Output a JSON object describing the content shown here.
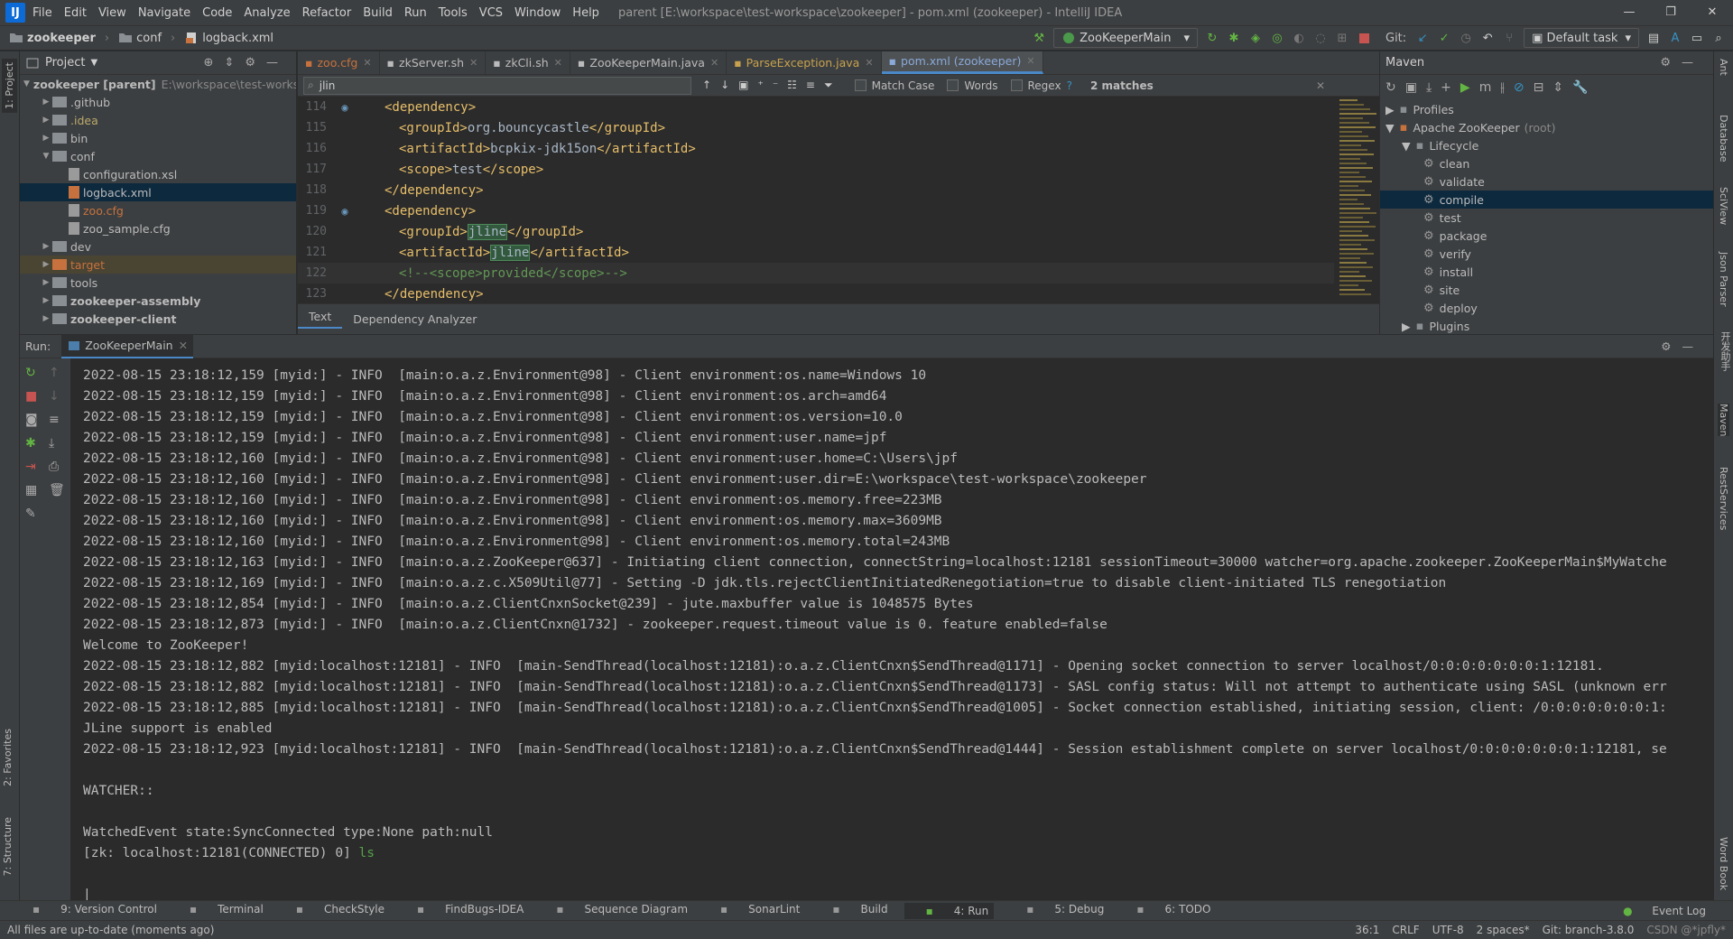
{
  "app": {
    "window_title": "parent [E:\\workspace\\test-workspace\\zookeeper] - pom.xml (zookeeper) - IntelliJ IDEA"
  },
  "menu": [
    "File",
    "Edit",
    "View",
    "Navigate",
    "Code",
    "Analyze",
    "Refactor",
    "Build",
    "Run",
    "Tools",
    "VCS",
    "Window",
    "Help"
  ],
  "window_controls": [
    "—",
    "❐",
    "✕"
  ],
  "nav": {
    "breadcrumbs": [
      "zookeeper",
      "conf",
      "logback.xml"
    ],
    "run_config": "ZooKeeperMain",
    "git_label": "Git:",
    "task": "Default task"
  },
  "project": {
    "title": "Project",
    "items": [
      {
        "label": "zookeeper [parent]",
        "extra": "E:\\workspace\\test-works",
        "bold": true,
        "arrow": "▼",
        "indent": 0
      },
      {
        "label": ".github",
        "arrow": "▶",
        "indent": 1
      },
      {
        "label": ".idea",
        "arrow": "▶",
        "indent": 1,
        "color": "#bba96a"
      },
      {
        "label": "bin",
        "arrow": "▶",
        "indent": 1
      },
      {
        "label": "conf",
        "arrow": "▼",
        "indent": 1
      },
      {
        "label": "configuration.xsl",
        "arrow": "",
        "indent": 2
      },
      {
        "label": "logback.xml",
        "arrow": "",
        "indent": 2,
        "sel": true
      },
      {
        "label": "zoo.cfg",
        "arrow": "",
        "indent": 2,
        "color": "#c7723e"
      },
      {
        "label": "zoo_sample.cfg",
        "arrow": "",
        "indent": 2
      },
      {
        "label": "dev",
        "arrow": "▶",
        "indent": 1
      },
      {
        "label": "target",
        "arrow": "▶",
        "indent": 1,
        "color": "#c7723e",
        "hl": true
      },
      {
        "label": "tools",
        "arrow": "▶",
        "indent": 1
      },
      {
        "label": "zookeeper-assembly",
        "arrow": "▶",
        "indent": 1,
        "bold": true
      },
      {
        "label": "zookeeper-client",
        "arrow": "▶",
        "indent": 1,
        "bold": true
      }
    ]
  },
  "editor": {
    "tabs": [
      {
        "label": "zoo.cfg",
        "color": "#c7723e"
      },
      {
        "label": "zkServer.sh",
        "color": "#bbbbbb"
      },
      {
        "label": "zkCli.sh",
        "color": "#bbbbbb"
      },
      {
        "label": "ZooKeeperMain.java",
        "color": "#bbbbbb"
      },
      {
        "label": "ParseException.java",
        "color": "#c7a24e"
      },
      {
        "label": "pom.xml (zookeeper)",
        "color": "#8aa8d8",
        "active": true
      }
    ],
    "search": {
      "query": "jlin",
      "match_case": "Match Case",
      "words": "Words",
      "regex": "Regex",
      "help": "?",
      "matches": "2 matches"
    },
    "lines": [
      {
        "n": "114",
        "html": "<span class='tagc'>&lt;dependency&gt;</span>",
        "indent": 4
      },
      {
        "n": "115",
        "html": "<span class='tagc'>&lt;groupId&gt;</span><span class='txt'>org.bouncycastle</span><span class='tagc'>&lt;/groupId&gt;</span>",
        "indent": 6
      },
      {
        "n": "116",
        "html": "<span class='tagc'>&lt;artifactId&gt;</span><span class='txt'>bcpkix-jdk15on</span><span class='tagc'>&lt;/artifactId&gt;</span>",
        "indent": 6
      },
      {
        "n": "117",
        "html": "<span class='tagc'>&lt;scope&gt;</span><span class='txt'>test</span><span class='tagc'>&lt;/scope&gt;</span>",
        "indent": 6
      },
      {
        "n": "118",
        "html": "<span class='tagc'>&lt;/dependency&gt;</span>",
        "indent": 4
      },
      {
        "n": "119",
        "html": "<span class='tagc'>&lt;dependency&gt;</span>",
        "indent": 4
      },
      {
        "n": "120",
        "html": "<span class='tagc'>&lt;groupId&gt;</span><span class='txt mark'>jline</span><span class='tagc'>&lt;/groupId&gt;</span>",
        "indent": 6
      },
      {
        "n": "121",
        "html": "<span class='tagc'>&lt;artifactId&gt;</span><span class='txt mark'>jline</span><span class='tagc'>&lt;/artifactId&gt;</span>",
        "indent": 6
      },
      {
        "n": "122",
        "html": "<span class='cmt'>&lt;!--&lt;scope&gt;provided&lt;/scope&gt;--&gt;</span>",
        "indent": 6,
        "active": true
      },
      {
        "n": "123",
        "html": "<span class='tagc'>&lt;/dependency&gt;</span>",
        "indent": 4
      }
    ],
    "bottom_tabs": [
      "Text",
      "Dependency Analyzer"
    ]
  },
  "maven": {
    "title": "Maven",
    "rows": [
      {
        "label": "Profiles",
        "arrow": "▶",
        "indent": 0,
        "icon": "folder"
      },
      {
        "label": "Apache ZooKeeper",
        "suffix": "(root)",
        "arrow": "▼",
        "indent": 0,
        "icon": "maven"
      },
      {
        "label": "Lifecycle",
        "arrow": "▼",
        "indent": 1,
        "icon": "folder"
      },
      {
        "label": "clean",
        "indent": 2,
        "icon": "gear"
      },
      {
        "label": "validate",
        "indent": 2,
        "icon": "gear"
      },
      {
        "label": "compile",
        "indent": 2,
        "icon": "gear",
        "sel": true
      },
      {
        "label": "test",
        "indent": 2,
        "icon": "gear"
      },
      {
        "label": "package",
        "indent": 2,
        "icon": "gear"
      },
      {
        "label": "verify",
        "indent": 2,
        "icon": "gear"
      },
      {
        "label": "install",
        "indent": 2,
        "icon": "gear"
      },
      {
        "label": "site",
        "indent": 2,
        "icon": "gear"
      },
      {
        "label": "deploy",
        "indent": 2,
        "icon": "gear"
      },
      {
        "label": "Plugins",
        "arrow": "▶",
        "indent": 1,
        "icon": "folder"
      }
    ]
  },
  "run": {
    "label": "Run:",
    "tab": "ZooKeeperMain",
    "console": [
      {
        "t": "2022-08-15 23:18:12,159 [myid:] - INFO  [main:o.a.z.Environment@98] - Client environment:os.name=Windows 10"
      },
      {
        "t": "2022-08-15 23:18:12,159 [myid:] - INFO  [main:o.a.z.Environment@98] - Client environment:os.arch=amd64"
      },
      {
        "t": "2022-08-15 23:18:12,159 [myid:] - INFO  [main:o.a.z.Environment@98] - Client environment:os.version=10.0"
      },
      {
        "t": "2022-08-15 23:18:12,159 [myid:] - INFO  [main:o.a.z.Environment@98] - Client environment:user.name=jpf"
      },
      {
        "t": "2022-08-15 23:18:12,160 [myid:] - INFO  [main:o.a.z.Environment@98] - Client environment:user.home=C:\\Users\\jpf"
      },
      {
        "t": "2022-08-15 23:18:12,160 [myid:] - INFO  [main:o.a.z.Environment@98] - Client environment:user.dir=E:\\workspace\\test-workspace\\zookeeper"
      },
      {
        "t": "2022-08-15 23:18:12,160 [myid:] - INFO  [main:o.a.z.Environment@98] - Client environment:os.memory.free=223MB"
      },
      {
        "t": "2022-08-15 23:18:12,160 [myid:] - INFO  [main:o.a.z.Environment@98] - Client environment:os.memory.max=3609MB"
      },
      {
        "t": "2022-08-15 23:18:12,160 [myid:] - INFO  [main:o.a.z.Environment@98] - Client environment:os.memory.total=243MB"
      },
      {
        "t": "2022-08-15 23:18:12,163 [myid:] - INFO  [main:o.a.z.ZooKeeper@637] - Initiating client connection, connectString=localhost:12181 sessionTimeout=30000 watcher=org.apache.zookeeper.ZooKeeperMain$MyWatche"
      },
      {
        "t": "2022-08-15 23:18:12,169 [myid:] - INFO  [main:o.a.z.c.X509Util@77] - Setting -D jdk.tls.rejectClientInitiatedRenegotiation=true to disable client-initiated TLS renegotiation"
      },
      {
        "t": "2022-08-15 23:18:12,854 [myid:] - INFO  [main:o.a.z.ClientCnxnSocket@239] - jute.maxbuffer value is 1048575 Bytes"
      },
      {
        "t": "2022-08-15 23:18:12,873 [myid:] - INFO  [main:o.a.z.ClientCnxn@1732] - zookeeper.request.timeout value is 0. feature enabled=false"
      },
      {
        "t": "Welcome to ZooKeeper!"
      },
      {
        "t": "2022-08-15 23:18:12,882 [myid:localhost:12181] - INFO  [main-SendThread(localhost:12181):o.a.z.ClientCnxn$SendThread@1171] - Opening socket connection to server localhost/0:0:0:0:0:0:0:1:12181."
      },
      {
        "t": "2022-08-15 23:18:12,882 [myid:localhost:12181] - INFO  [main-SendThread(localhost:12181):o.a.z.ClientCnxn$SendThread@1173] - SASL config status: Will not attempt to authenticate using SASL (unknown err"
      },
      {
        "t": "2022-08-15 23:18:12,885 [myid:localhost:12181] - INFO  [main-SendThread(localhost:12181):o.a.z.ClientCnxn$SendThread@1005] - Socket connection established, initiating session, client: /0:0:0:0:0:0:0:1:"
      },
      {
        "t": "JLine support is enabled"
      },
      {
        "t": "2022-08-15 23:18:12,923 [myid:localhost:12181] - INFO  [main-SendThread(localhost:12181):o.a.z.ClientCnxn$SendThread@1444] - Session establishment complete on server localhost/0:0:0:0:0:0:0:1:12181, se"
      },
      {
        "t": ""
      },
      {
        "t": "WATCHER::"
      },
      {
        "t": ""
      },
      {
        "t": "WatchedEvent state:SyncConnected type:None path:null"
      },
      {
        "t": "[zk: localhost:12181(CONNECTED) 0] ",
        "green": "ls"
      },
      {
        "t": ""
      }
    ]
  },
  "bottom_tabs": [
    {
      "label": "9: Version Control"
    },
    {
      "label": "Terminal"
    },
    {
      "label": "CheckStyle"
    },
    {
      "label": "FindBugs-IDEA"
    },
    {
      "label": "Sequence Diagram"
    },
    {
      "label": "SonarLint"
    },
    {
      "label": "Build"
    },
    {
      "label": "4: Run",
      "active": true
    },
    {
      "label": "5: Debug"
    },
    {
      "label": "6: TODO"
    }
  ],
  "event_log": "Event Log",
  "status": {
    "message": "All files are up-to-date (moments ago)",
    "position": "36:1",
    "line_sep": "CRLF",
    "encoding": "UTF-8",
    "indent": "2 spaces*",
    "branch": "Git: branch-3.8.0",
    "watermark": "CSDN @*jpfly*"
  },
  "left_strip": [
    "1: Project",
    "2: Favorites",
    "7: Structure"
  ],
  "right_strip": [
    "Ant",
    "Database",
    "SciView",
    "Json Parser",
    "开发助手",
    "Maven",
    "RestServices",
    "Word Book"
  ]
}
